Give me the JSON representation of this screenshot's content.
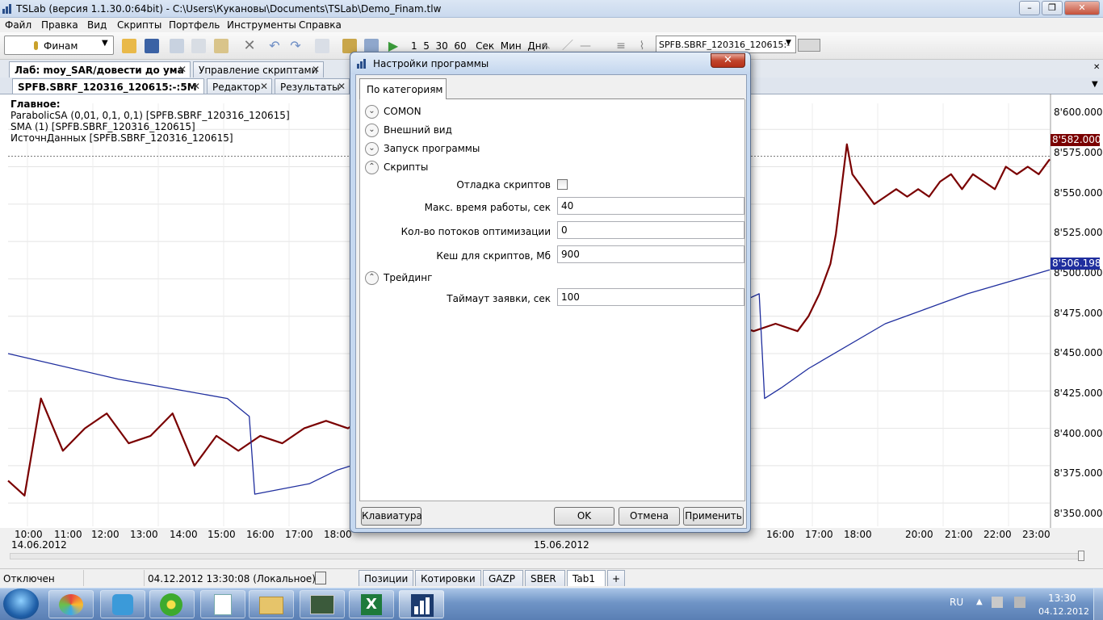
{
  "window": {
    "title": "TSLab (версия 1.1.30.0:64bit) - C:\\Users\\Кукановы\\Documents\\TSLab\\Demo_Finam.tlw"
  },
  "menu": [
    "Файл",
    "Правка",
    "Вид",
    "Скрипты",
    "Портфель",
    "Инструменты",
    "Справка"
  ],
  "toolbar": {
    "broker": "Финам",
    "timeframes": "1  5  30  60   Сек  Мин  Дни",
    "symbol": "SPFB.SBRF_120316_120615:-"
  },
  "tabs_top": [
    {
      "label": "Лаб: moy_SAR/довести до ума",
      "active": true
    },
    {
      "label": "Управление скриптами",
      "active": false
    }
  ],
  "tabs_sub": [
    {
      "label": "SPFB.SBRF_120316_120615:-:5M",
      "active": true
    },
    {
      "label": "Редактор",
      "active": false
    },
    {
      "label": "Результаты",
      "active": false
    }
  ],
  "legend": {
    "header": "Главное:",
    "lines": [
      {
        "text": "ParabolicSA (0,01, 0,1, 0,1) [SPFB.SBRF_120316_120615]",
        "color": "#1f2e9e"
      },
      {
        "text": "SMA (1) [SPFB.SBRF_120316_120615]",
        "color": "#000000"
      },
      {
        "text": "ИсточнДанных [SPFB.SBRF_120316_120615]",
        "color": "#7a0000"
      }
    ]
  },
  "chart_data": {
    "type": "line",
    "y_ticks": [
      "8'600.000",
      "8'575.000",
      "8'550.000",
      "8'525.000",
      "8'500.000",
      "8'475.000",
      "8'450.000",
      "8'425.000",
      "8'400.000",
      "8'375.000",
      "8'350.000"
    ],
    "ylim": [
      8342,
      8612
    ],
    "x_ticks": [
      "10:00",
      "11:00",
      "12:00",
      "13:00",
      "14:00",
      "15:00",
      "16:00",
      "17:00",
      "18:00",
      "16:00",
      "17:00",
      "18:00",
      "20:00",
      "21:00",
      "22:00",
      "23:00"
    ],
    "dates": [
      "14.06.2012",
      "15.06.2012"
    ],
    "price_label": {
      "value": "8'582.000",
      "color": "#7a0000"
    },
    "sar_label": {
      "value": "8'506.198",
      "color": "#1f2e9e"
    },
    "series": [
      {
        "name": "ИсточнДанных",
        "color": "#7a0000",
        "points": [
          [
            0,
            8365
          ],
          [
            3,
            8355
          ],
          [
            6,
            8420
          ],
          [
            10,
            8385
          ],
          [
            14,
            8400
          ],
          [
            18,
            8410
          ],
          [
            22,
            8390
          ],
          [
            26,
            8395
          ],
          [
            30,
            8410
          ],
          [
            34,
            8375
          ],
          [
            38,
            8395
          ],
          [
            42,
            8385
          ],
          [
            46,
            8395
          ],
          [
            50,
            8390
          ],
          [
            54,
            8400
          ],
          [
            58,
            8405
          ],
          [
            62,
            8400
          ],
          [
            66,
            8410
          ],
          [
            70,
            8405
          ],
          [
            74,
            8400
          ],
          [
            78,
            8395
          ],
          [
            82,
            8400
          ],
          [
            86,
            8420
          ],
          [
            88,
            8390
          ],
          [
            90,
            8375
          ],
          [
            92,
            8400
          ],
          [
            94,
            8415
          ],
          [
            96,
            8405
          ],
          [
            98,
            8395
          ],
          [
            100,
            8415
          ],
          [
            102,
            8430
          ],
          [
            104,
            8440
          ],
          [
            108,
            8430
          ],
          [
            112,
            8440
          ],
          [
            120,
            8460
          ],
          [
            124,
            8455
          ],
          [
            128,
            8460
          ],
          [
            132,
            8470
          ],
          [
            136,
            8465
          ],
          [
            140,
            8470
          ],
          [
            144,
            8465
          ],
          [
            146,
            8475
          ],
          [
            148,
            8490
          ],
          [
            150,
            8510
          ],
          [
            151,
            8530
          ],
          [
            152,
            8560
          ],
          [
            153,
            8590
          ],
          [
            154,
            8570
          ],
          [
            156,
            8560
          ],
          [
            158,
            8550
          ],
          [
            160,
            8555
          ],
          [
            162,
            8560
          ],
          [
            164,
            8555
          ],
          [
            166,
            8560
          ],
          [
            168,
            8555
          ],
          [
            170,
            8565
          ],
          [
            172,
            8570
          ],
          [
            174,
            8560
          ],
          [
            176,
            8570
          ],
          [
            178,
            8565
          ],
          [
            180,
            8560
          ],
          [
            182,
            8575
          ],
          [
            184,
            8570
          ],
          [
            186,
            8575
          ],
          [
            188,
            8570
          ],
          [
            190,
            8580
          ]
        ]
      },
      {
        "name": "ParabolicSA",
        "color": "#1f2e9e",
        "points": [
          [
            0,
            8450
          ],
          [
            20,
            8433
          ],
          [
            40,
            8420
          ],
          [
            44,
            8408
          ],
          [
            45,
            8356
          ],
          [
            55,
            8363
          ],
          [
            60,
            8372
          ],
          [
            80,
            8395
          ],
          [
            137,
            8490
          ],
          [
            138,
            8420
          ],
          [
            141,
            8427
          ],
          [
            146,
            8440
          ],
          [
            160,
            8470
          ],
          [
            175,
            8490
          ],
          [
            190,
            8506
          ]
        ]
      }
    ]
  },
  "dialog": {
    "title": "Настройки программы",
    "tab": "По категориям",
    "sections": [
      "COMON",
      "Внешний вид",
      "Запуск программы",
      "Скрипты",
      "Трейдинг"
    ],
    "fields": {
      "debug_label": "Отладка скриптов",
      "debug_checked": false,
      "maxtime_label": "Макс. время работы, сек",
      "maxtime_value": "40",
      "threads_label": "Кол-во потоков оптимизации",
      "threads_value": "0",
      "cache_label": "Кеш для скриптов, Мб",
      "cache_value": "900",
      "timeout_label": "Таймаут заявки, сек",
      "timeout_value": "100"
    },
    "buttons": {
      "keyboard": "Клавиатура",
      "ok": "OK",
      "cancel": "Отмена",
      "apply": "Применить"
    }
  },
  "statusbar": {
    "connection": "Отключен",
    "datetime": "04.12.2012 13:30:08 (Локальное)",
    "bottom_tabs": [
      "Позиции",
      "Котировки",
      "GAZP",
      "SBER",
      "Tab1",
      "+"
    ]
  },
  "taskbar": {
    "lang": "RU",
    "time": "13:30",
    "date": "04.12.2012"
  }
}
